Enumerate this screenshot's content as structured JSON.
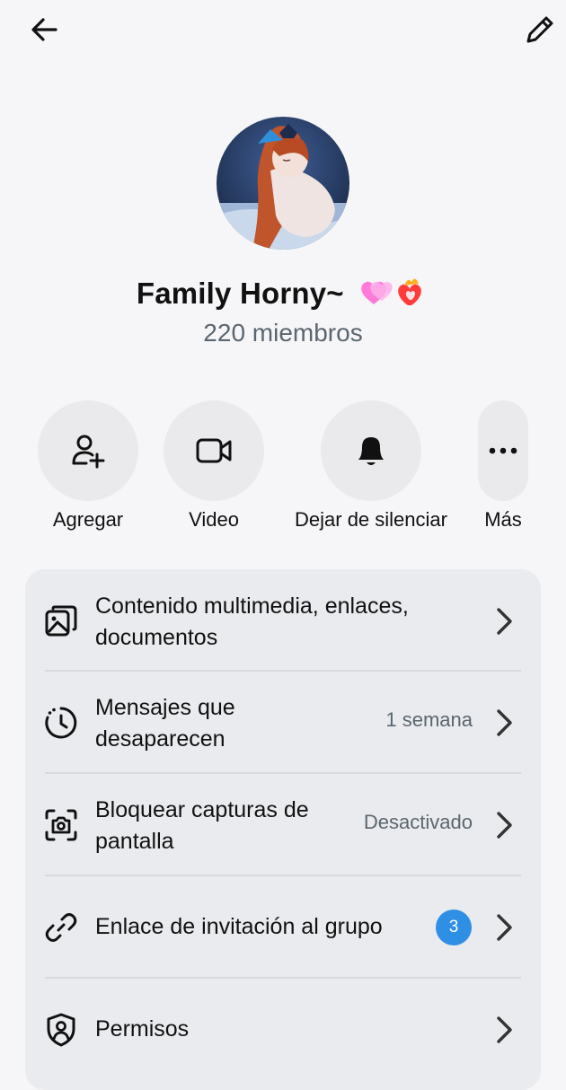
{
  "group": {
    "name": "Family Horny~",
    "members": "220 miembros"
  },
  "actions": [
    {
      "label": "Agregar",
      "icon": "add-user-icon"
    },
    {
      "label": "Video",
      "icon": "video-camera-icon"
    },
    {
      "label": "Dejar de silenciar",
      "icon": "bell-icon"
    },
    {
      "label": "Más",
      "icon": "more-icon"
    }
  ],
  "settings": [
    {
      "label": "Contenido multimedia, enlaces, documentos",
      "icon": "media-gallery-icon",
      "value": ""
    },
    {
      "label": "Mensajes que desaparecen",
      "icon": "disappearing-timer-icon",
      "value": "1 semana"
    },
    {
      "label": "Bloquear capturas de pantalla",
      "icon": "screenshot-block-icon",
      "value": "Desactivado"
    },
    {
      "label": "Enlace de invitación al grupo",
      "icon": "link-icon",
      "badge": "3"
    },
    {
      "label": "Permisos",
      "icon": "shield-user-icon",
      "value": ""
    }
  ],
  "colors": {
    "background": "#f6f6f8",
    "panel": "#eaebee",
    "badge": "#2e8fe5",
    "secondary_text": "#5b6670"
  }
}
